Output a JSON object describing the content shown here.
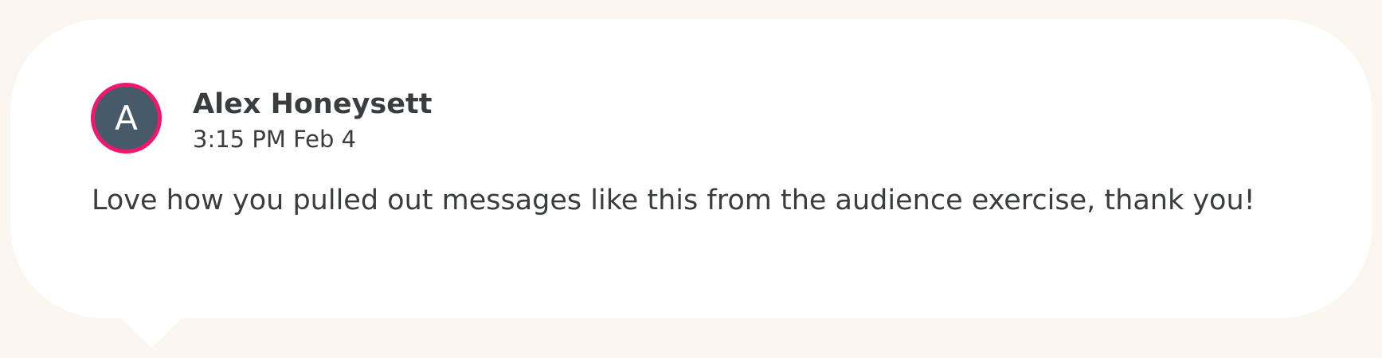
{
  "comment": {
    "avatar_initial": "A",
    "author": "Alex Honeysett",
    "timestamp": "3:15 PM Feb 4",
    "message": "Love how you pulled out messages like this from the audience exercise, thank you!"
  },
  "colors": {
    "page_background": "#fbf6f0",
    "bubble_background": "#ffffff",
    "avatar_ring": "#f0176f",
    "avatar_fill": "#475a6a",
    "text": "#3a3d40"
  },
  "icons": {
    "bubble_tail": "speech-bubble-tail"
  }
}
